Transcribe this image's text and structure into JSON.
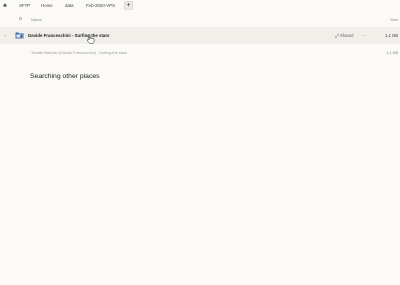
{
  "breadcrumb": {
    "items": [
      "SFTP",
      "Home",
      "data",
      "Feb-2020-VPS"
    ],
    "add_label": "+"
  },
  "list": {
    "header_name": "Name",
    "header_size": "Size",
    "rows": [
      {
        "name": "Davide Franceschini - Surfing the stars",
        "shared_label": "Shared",
        "more_label": "···",
        "size": "1.1 GB"
      }
    ]
  },
  "nested_path": {
    "text": "/ Beatle Watcher (Davide Franceschini) - Surfing the stars",
    "size": "1.1 GB"
  },
  "search_section": {
    "title": "Searching other places"
  },
  "colors": {
    "background": "#fbfaf7",
    "row_highlight": "#f1efea",
    "folder_accent": "#3f6fb4"
  },
  "icons": [
    "home-icon",
    "folder-icon",
    "link-icon",
    "more-icon",
    "star-icon",
    "cursor-icon"
  ]
}
